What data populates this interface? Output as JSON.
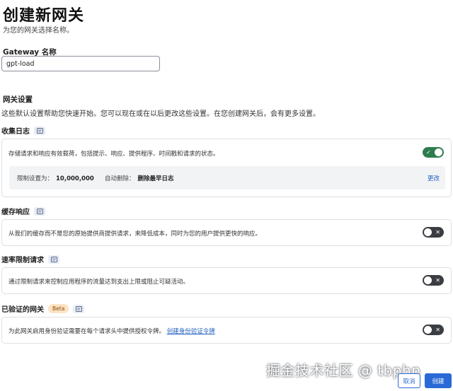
{
  "header": {
    "title": "创建新网关",
    "subtitle": "为您的网关选择名称。"
  },
  "gateway_name": {
    "label": "Gateway 名称",
    "value": "gpt-load"
  },
  "settings": {
    "heading": "网关设置",
    "description": "这些默认设置帮助您快速开始。您可以现在或在以后更改这些设置。在您创建网关后，会有更多设置。"
  },
  "sections": {
    "logs": {
      "title": "收集日志",
      "description": "存储请求和响应有效载荷，包括提示、响应、提供程序、时间戳和请求的状态。",
      "enabled": true,
      "limit_label": "限制设置为：",
      "limit_value": "10,000,000",
      "auto_delete_label": "自动删除：",
      "auto_delete_value": "删除最早日志",
      "change_link": "更改"
    },
    "cache": {
      "title": "缓存响应",
      "description": "从我们的缓存而不是您的原始提供商提供请求，来降低成本，同时为您的用户提供更快的响应。",
      "enabled": false
    },
    "rate_limit": {
      "title": "速率限制请求",
      "description": "通过限制请求来控制应用程序的流量达到支出上限或阻止可疑活动。",
      "enabled": false
    },
    "auth": {
      "title": "已验证的网关",
      "badge": "Beta",
      "description": "为此网关启用身份验证需要在每个请求头中提供授权令牌。",
      "link": "创建身份验证令牌",
      "enabled": false
    }
  },
  "icons": {
    "toggle_on": "check-icon",
    "toggle_off": "x-icon",
    "section_doc": "document-icon"
  },
  "footer": {
    "cancel_label": "取消",
    "create_label": "创建"
  },
  "watermark": "掘金技术社区 @ tbphp",
  "colors": {
    "accent": "#2a6ad6",
    "toggle_on": "#2e7d4f",
    "toggle_off": "#3a3d42",
    "beta_badge": "#fbe3c4"
  }
}
